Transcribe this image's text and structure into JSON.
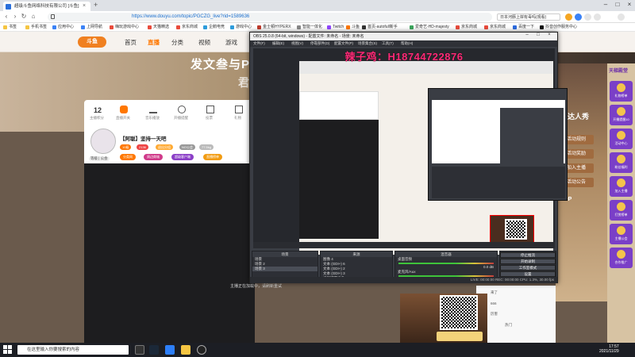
{
  "browser": {
    "tab_title": "超级斗鱼网络科技有限公司 [斗鱼]",
    "url": "https://www.douyu.com/topic/PGCZG_live?rid=1589636",
    "search_box": "日本河豚上岸有毒吗(观看)",
    "bookmarks": [
      "书签",
      "手机书签",
      "应用中心",
      "上网导航",
      "嗨玩游戏中心",
      "天猫精选",
      "京东商城",
      "企鹅电竞",
      "游戏中心",
      "金士顿HYPERX",
      "智能一体化",
      "Twitch",
      "斗鱼",
      "首页-autofull新手",
      "爱奇艺-HD-majesty",
      "京东商城",
      "京东商城",
      "百度一下",
      "抖音创作服务中心"
    ]
  },
  "site": {
    "logo": "斗鱼",
    "nav": [
      "首页",
      "直播",
      "分类",
      "视频",
      "游戏"
    ],
    "banner_title": "发文叁与P",
    "banner_sub": "君",
    "stats": [
      {
        "num": "12",
        "label": "主播积分"
      },
      {
        "num": "",
        "label": "直播开关"
      },
      {
        "num": "",
        "label": "音乐播放"
      },
      {
        "num": "",
        "label": "开播提醒"
      },
      {
        "num": "",
        "label": "投票"
      },
      {
        "num": "",
        "label": "礼物"
      }
    ],
    "room_title": "【阿聪】坚持一天吧",
    "room_meta": "阿聪",
    "avatar_label": "等级 | 公会",
    "badges": [
      "10级",
      "2136",
      "退出分组",
      "NO公会",
      "77.5kg"
    ],
    "pills": [
      "分类网",
      "周边商城",
      "超级客户端",
      "直播榜单"
    ],
    "video_tip": "主播正在加载中，请刷新重试",
    "chat_lines": [
      "来了",
      "666",
      "厉害",
      "热门"
    ],
    "right_banner": {
      "top": "天梯殿堂",
      "mid": "主达人秀",
      "btn1": "活动规则",
      "btn2": "活动奖励",
      "btn3": "加入主播",
      "btn4": "活动公告",
      "bottom": "TOP"
    },
    "side_items": [
      "礼物榜单",
      "开播提醒10",
      "活动中心",
      "粉丝福利",
      "加入主播",
      "打赏榜单",
      "主播公会",
      "合作推广"
    ]
  },
  "obs": {
    "title": "OBS 25.0.8 (64-bit, windows) - 配置文件: 未命名 - 场景: 未命名",
    "menu": [
      "文件(F)",
      "编辑(E)",
      "视图(V)",
      "停靠部件(D)",
      "配置文件(P)",
      "场景集合(S)",
      "工具(T)",
      "帮助(H)"
    ],
    "preview_caption": "辣子鸡：H18744722876",
    "scenes_header": "场景",
    "scenes": [
      "场景",
      "场景 2",
      "场景 3"
    ],
    "sources_header": "来源",
    "sources": [
      "图像 4",
      "文本 (GDI+) 6",
      "文本 (GDI+) 2",
      "文本 (GDI+) 3",
      "视频捕获设备",
      "窗口捕获"
    ],
    "mixer_header": "混音器",
    "mixer": [
      {
        "name": "桌面音频",
        "db": "0.0 dB"
      },
      {
        "name": "麦克风/Aux",
        "db": "0.0 dB"
      }
    ],
    "transitions_header": "转场特效",
    "controls_header": "控件",
    "controls": [
      "停止推流",
      "开始录制",
      "工作室模式",
      "设置",
      "退出"
    ],
    "bottom_tabs": [
      "控件",
      "场景转场特效"
    ],
    "status": "LIVE: 00:00:00   REC: 00:00:00   CPU: 1.3%, 30.00 fps"
  },
  "taskbar": {
    "search": "在这里输入你要搜索的内容",
    "time": "17:57",
    "date": "2021/11/29"
  }
}
